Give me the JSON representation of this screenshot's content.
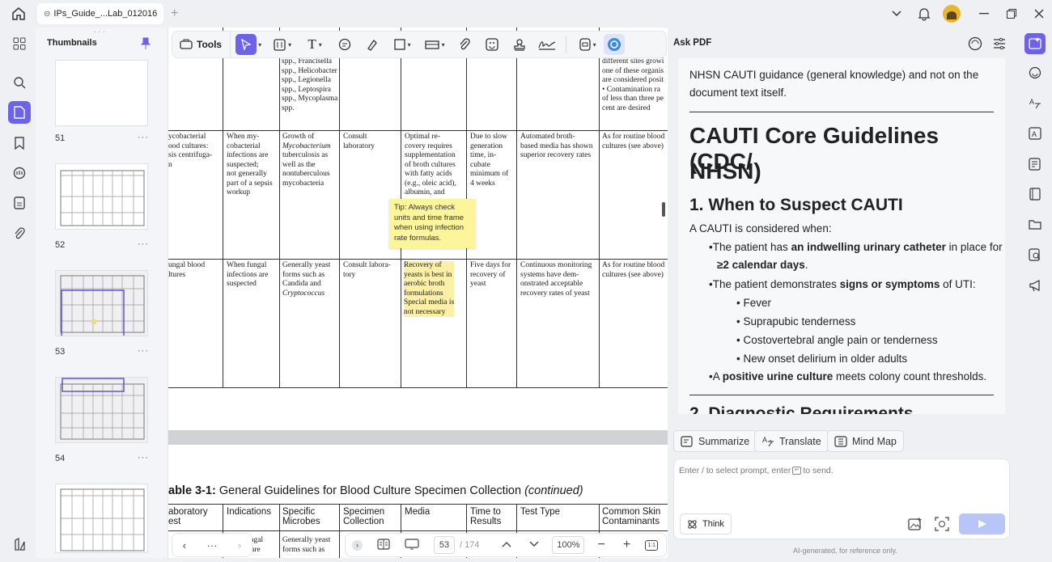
{
  "titlebar": {
    "tab_title": "IPs_Guide_...Lab_012016",
    "new_tab": "+"
  },
  "thumbnails": {
    "header": "Thumbnails",
    "pages": [
      {
        "num": "51"
      },
      {
        "num": "52"
      },
      {
        "num": "53"
      },
      {
        "num": "54"
      }
    ],
    "more": "···"
  },
  "toolbar": {
    "tools_label": "Tools"
  },
  "doc": {
    "row1": {
      "c2": [
        "spp., Francisella",
        "spp., Helicobacter",
        "spp., Legionella",
        "spp., Leptospira",
        "spp., Mycoplasma",
        "spp."
      ],
      "c8": [
        "different sites growi",
        "one of these organis",
        "are considered posit",
        "• Contamination ra",
        "of less than three pe",
        "cent are desired"
      ]
    },
    "row2": {
      "c1": [
        "ycobacterial",
        "ood cultures:",
        "sis centrifuga-",
        "n"
      ],
      "c2": [
        "When my-",
        "cobacterial",
        "infections are",
        "suspected;",
        "not generally",
        "part of a sepsis",
        "workup"
      ],
      "c3": [
        "Growth of",
        "Mycobacterium",
        "tuberculosis as",
        "well as the",
        "nontuberculous",
        "mycobacteria"
      ],
      "c4": [
        "Consult",
        "laboratory"
      ],
      "c5": [
        "Optimal re-",
        "covery requires",
        "supplementation",
        "of broth cultures",
        "with fatty acids",
        "(e.g., oleic acid),",
        "albumin, and"
      ],
      "c6": [
        "Due to slow",
        "generation",
        "time, in-",
        "cubate",
        "minimum of",
        "4 weeks"
      ],
      "c7": [
        "Automated broth-",
        "based media has shown",
        "superior recovery rates"
      ],
      "c8": [
        "As for routine blood",
        "cultures (see above)"
      ]
    },
    "row3": {
      "c1": [
        "ungal blood",
        "ltures"
      ],
      "c2": [
        "When fungal",
        "infections are",
        "suspected"
      ],
      "c3": [
        "Generally yeast",
        "forms such as",
        "Candida and",
        "Cryptococcus"
      ],
      "c4": [
        "Consult labora-",
        "tory"
      ],
      "c5": [
        "Recovery of",
        "yeasts is best in",
        "aerobic broth",
        "formulations",
        "Special media is",
        "not necessary"
      ],
      "c6": [
        "Five days for",
        "recovery of",
        "yeast"
      ],
      "c7": [
        "Continuous monitoring",
        "systems have dem-",
        "onstrated acceptable",
        "recovery rates of yeast"
      ],
      "c8": [
        "As for routine blood",
        "cultures (see above)"
      ]
    },
    "tip": "Tip: Always check units and time frame when using infection rate formulas.",
    "table_caption_bold": "able 3-1:",
    "table_caption": " General Guidelines for Blood Culture Specimen Collection ",
    "table_caption_italic": "(continued)",
    "headers": [
      "aboratory\nest",
      "Indications",
      "Specific\nMicrobes",
      "Specimen\nCollection",
      "Media",
      "Time to\nResults",
      "Test Type",
      "Common Skin\nContaminants"
    ],
    "row4": {
      "c2": [
        "ungal",
        "s are"
      ],
      "c3": [
        "Generally yeast",
        "forms such as"
      ]
    }
  },
  "pager": {
    "page": "53",
    "total": "/ 174",
    "zoom": "100%",
    "fit": "1:1"
  },
  "ask": {
    "title": "Ask PDF",
    "intro": [
      "NHSN CAUTI guidance (general knowledge) and not on the",
      "document text itself."
    ],
    "h1a": "CAUTI Core Guidelines (CDC/",
    "h1b": "NHSN)",
    "h2": "1. When to Suspect CAUTI",
    "lead": "A CAUTI is considered when:",
    "b1_pre": "The patient has ",
    "b1_bold": "an indwelling urinary catheter",
    "b1_post": " in place for",
    "b1_line2_bold": "≥2 calendar days",
    "b1_line2_post": ".",
    "b2_pre": "The patient demonstrates ",
    "b2_bold": "signs or symptoms",
    "b2_post": " of UTI:",
    "sub": [
      "Fever",
      "Suprapubic tenderness",
      "Costovertebral angle pain or tenderness",
      "New onset delirium in older adults"
    ],
    "b3_pre": "A ",
    "b3_bold": "positive urine culture",
    "b3_post": " meets colony count thresholds.",
    "h2_next": "2. Diagnostic Requirements",
    "actions": {
      "summarize": "Summarize",
      "translate": "Translate",
      "mindmap": "Mind Map"
    },
    "input_prompt": "Enter / to select prompt, enter",
    "input_send": "to send.",
    "think": "Think",
    "footer": "AI-generated, for reference only."
  }
}
